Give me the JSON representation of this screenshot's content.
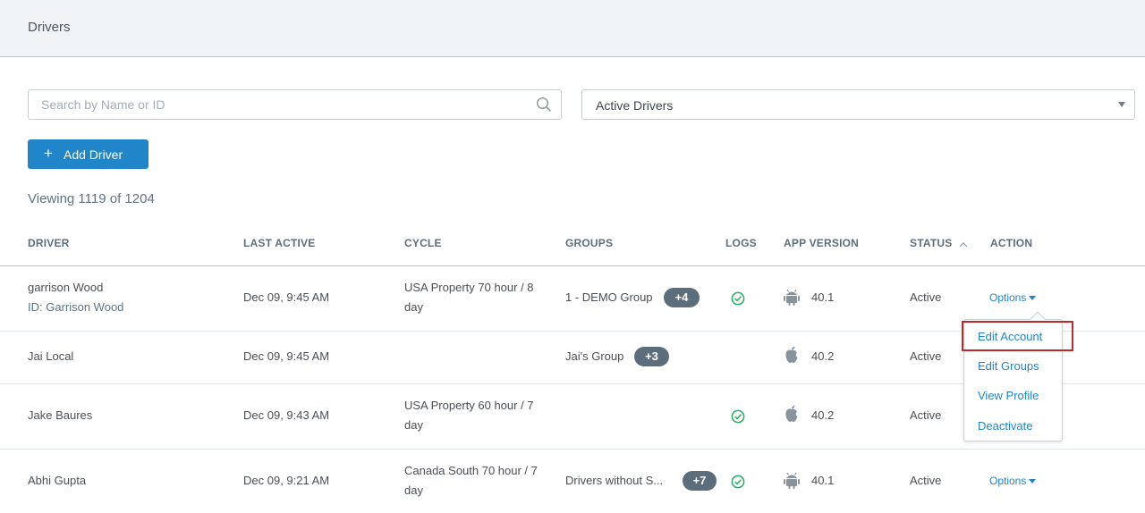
{
  "page": {
    "title": "Drivers"
  },
  "search": {
    "placeholder": "Search by Name or ID",
    "value": ""
  },
  "filter": {
    "selected": "Active Drivers"
  },
  "add_driver": {
    "label": "Add Driver"
  },
  "summary": {
    "viewing_text": "Viewing 1119 of 1204"
  },
  "table": {
    "columns": [
      "DRIVER",
      "LAST ACTIVE",
      "CYCLE",
      "GROUPS",
      "LOGS",
      "APP VERSION",
      "STATUS",
      "ACTION"
    ],
    "rows": [
      {
        "driver": "garrison Wood",
        "driver_id": "ID: Garrison Wood",
        "last_active": "Dec 09, 9:45 AM",
        "cycle_l1": "USA Property 70 hour / 8",
        "cycle_l2": "day",
        "group": "1 - DEMO Group",
        "group_more": "+4",
        "logs_ok": true,
        "platform": "android-icon",
        "app_version": "40.1",
        "status": "Active",
        "action": "Options"
      },
      {
        "driver": "Jai Local",
        "last_active": "Dec 09, 9:45 AM",
        "group": "Jai's Group",
        "group_more": "+3",
        "logs_ok": false,
        "platform": "apple-icon",
        "app_version": "40.2",
        "status": "Active"
      },
      {
        "driver": "Jake Baures",
        "last_active": "Dec 09, 9:43 AM",
        "cycle_l1": "USA Property 60 hour / 7",
        "cycle_l2": "day",
        "logs_ok": true,
        "platform": "apple-icon",
        "app_version": "40.2",
        "status": "Active"
      },
      {
        "driver": "Abhi Gupta",
        "last_active": "Dec 09, 9:21 AM",
        "cycle_l1": "Canada South 70 hour / 7",
        "cycle_l2": "day",
        "group": "Drivers without S...",
        "group_more": "+7",
        "logs_ok": true,
        "platform": "android-icon",
        "app_version": "40.1",
        "status": "Active",
        "action": "Options"
      }
    ]
  },
  "action_menu": {
    "items": [
      "Edit Account",
      "Edit Groups",
      "View Profile",
      "Deactivate"
    ],
    "highlighted": "Edit Account"
  },
  "colors": {
    "primary": "#2185c9",
    "success": "#27ae60",
    "badge": "#5c6e7c",
    "highlight": "#c0282d"
  }
}
